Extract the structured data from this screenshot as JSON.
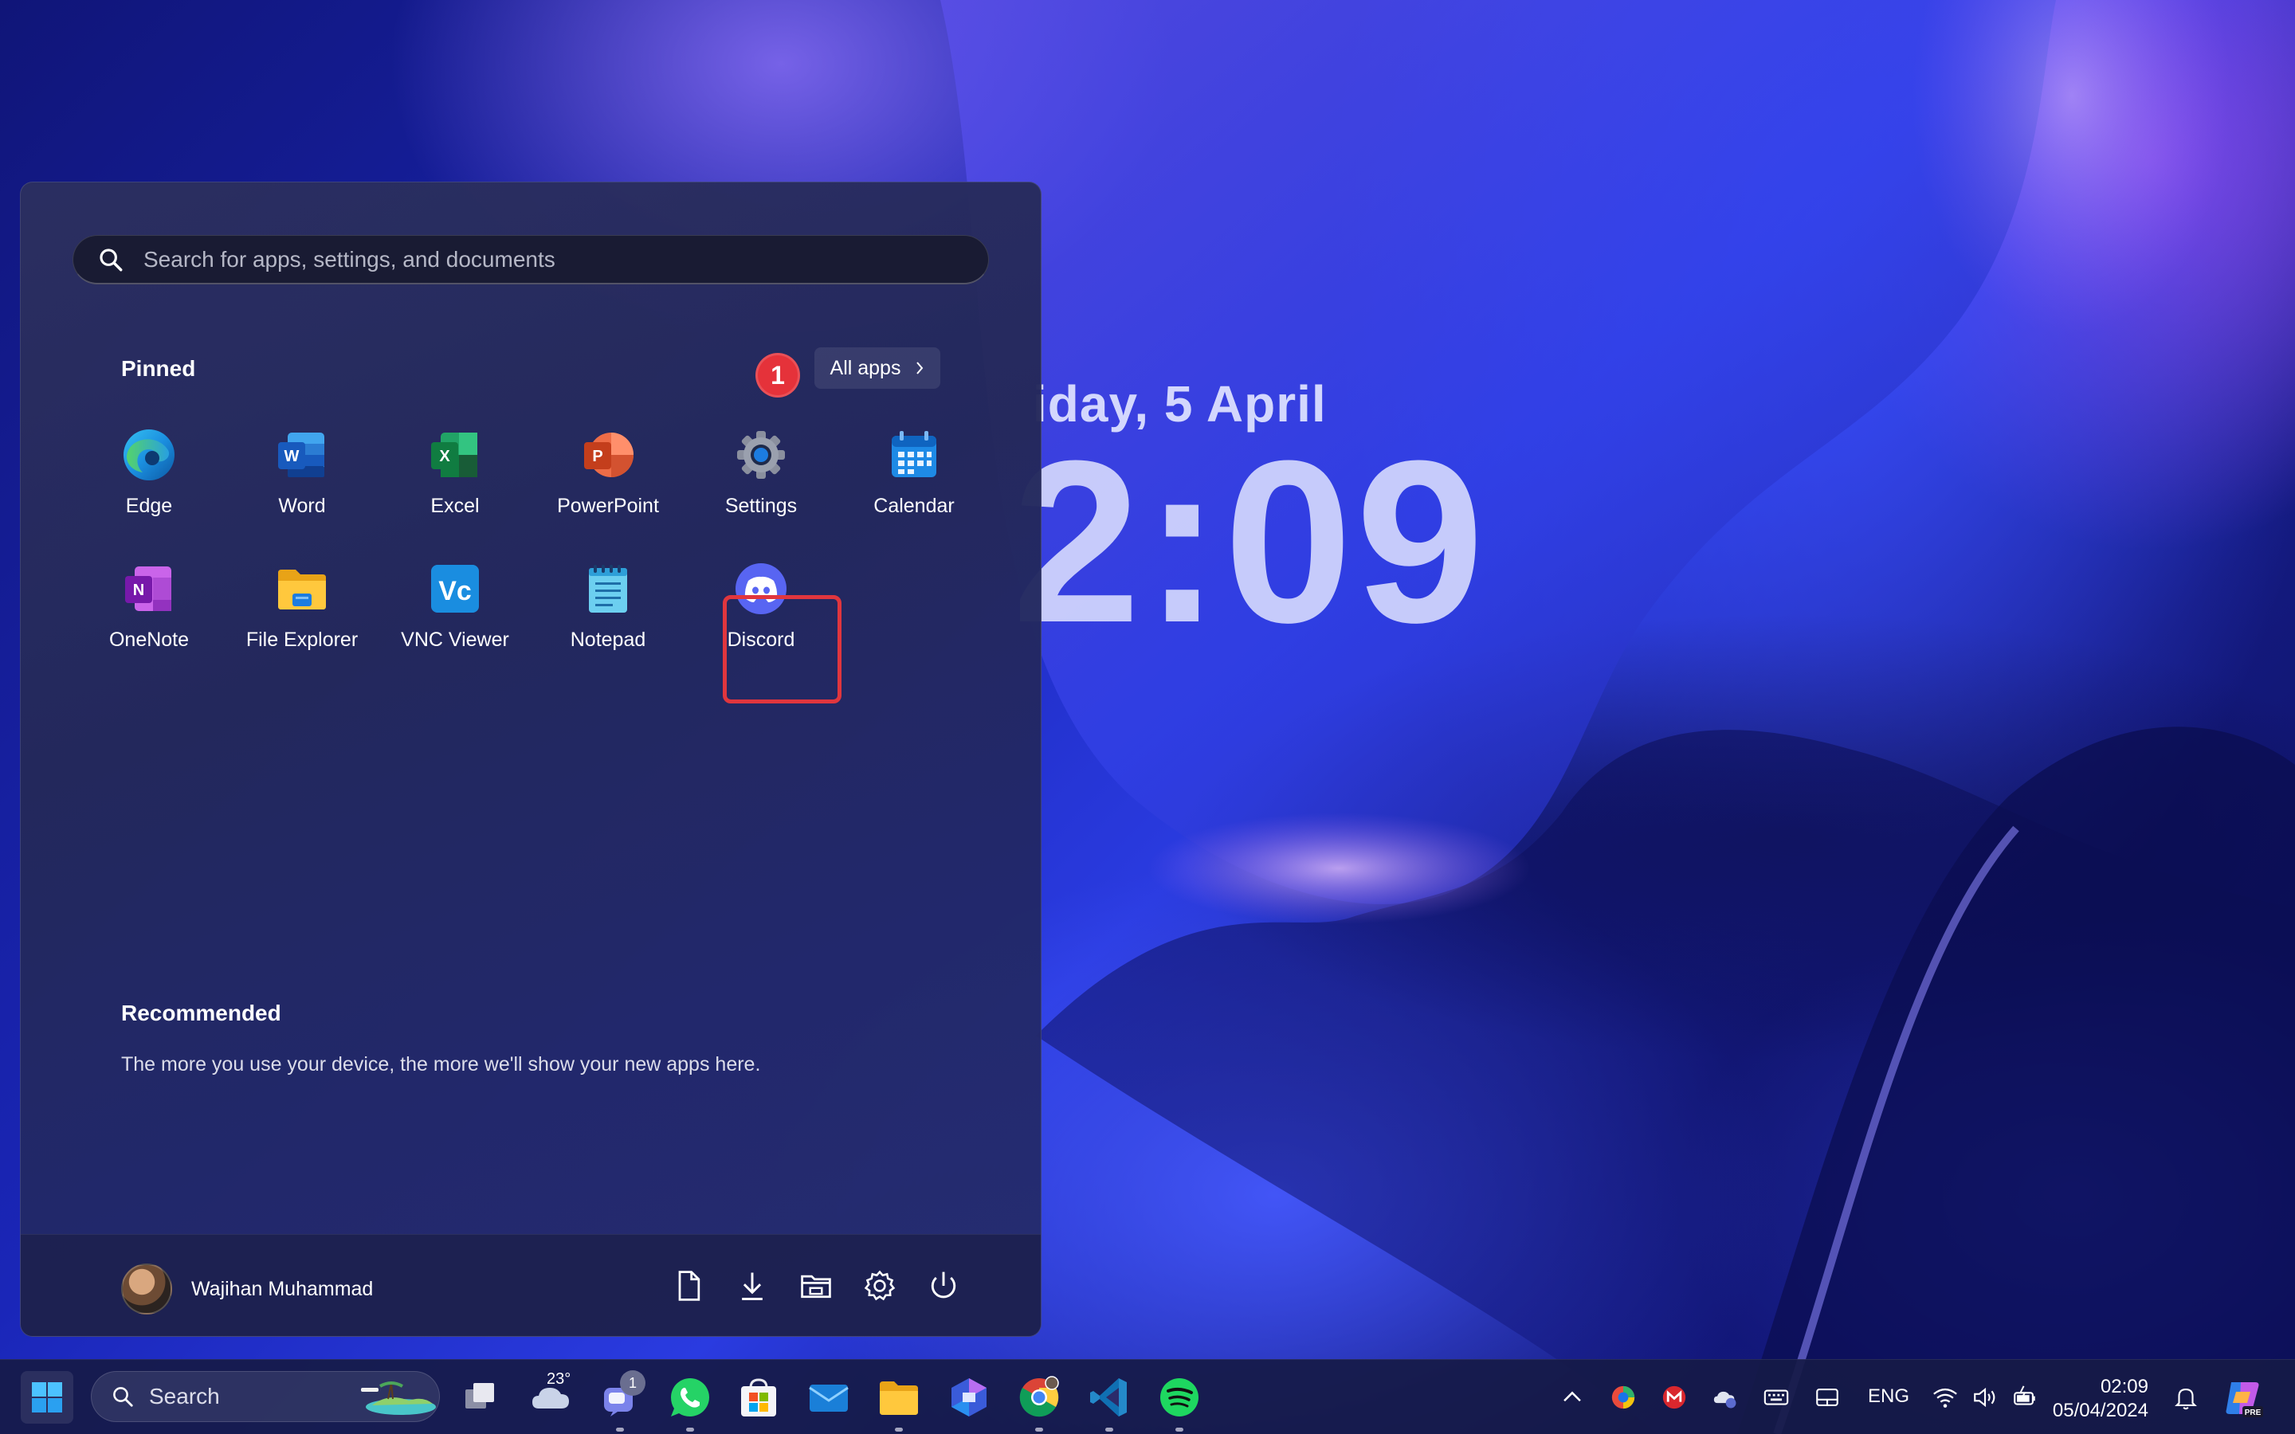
{
  "desktop": {
    "lock_date": "iday, 5 April",
    "lock_time": "2:09"
  },
  "start_menu": {
    "search_placeholder": "Search for apps, settings, and documents",
    "pinned_title": "Pinned",
    "all_apps_label": "All apps",
    "step_badge": "1",
    "pinned_apps": [
      {
        "label": "Edge",
        "icon": "edge-icon"
      },
      {
        "label": "Word",
        "icon": "word-icon"
      },
      {
        "label": "Excel",
        "icon": "excel-icon"
      },
      {
        "label": "PowerPoint",
        "icon": "powerpoint-icon"
      },
      {
        "label": "Settings",
        "icon": "settings-gear-icon"
      },
      {
        "label": "Calendar",
        "icon": "calendar-icon"
      },
      {
        "label": "OneNote",
        "icon": "onenote-icon"
      },
      {
        "label": "File Explorer",
        "icon": "folder-icon"
      },
      {
        "label": "VNC Viewer",
        "icon": "vnc-viewer-icon"
      },
      {
        "label": "Notepad",
        "icon": "notepad-icon"
      },
      {
        "label": "Discord",
        "icon": "discord-icon"
      }
    ],
    "recommended_title": "Recommended",
    "recommended_text": "The more you use your device, the more we'll show your new apps here.",
    "user_name": "Wajihan Muhammad",
    "footer_buttons": [
      "documents-icon",
      "downloads-icon",
      "file-explorer-icon",
      "settings-icon",
      "power-icon"
    ]
  },
  "taskbar": {
    "search_label": "Search",
    "weather_temp": "23°",
    "teams_badge": "1",
    "language": "ENG",
    "time": "02:09",
    "date": "05/04/2024",
    "pinned": [
      "task-view-icon",
      "weather-icon",
      "teams-icon",
      "whatsapp-icon",
      "microsoft-store-icon",
      "mail-icon",
      "file-explorer-icon",
      "copilot-icon",
      "chrome-icon",
      "vscode-icon",
      "spotify-icon"
    ]
  },
  "colors": {
    "highlight": "#e0363e",
    "accent_blue": "#0078d4"
  }
}
